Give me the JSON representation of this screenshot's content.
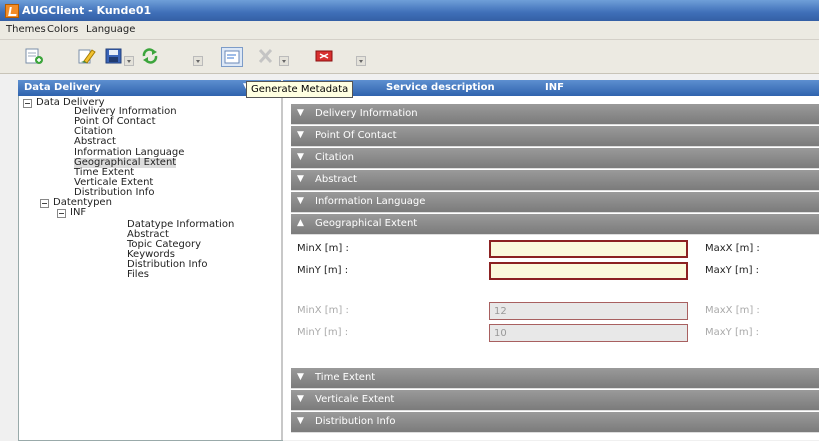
{
  "window": {
    "title": "AUGClient - Kunde01"
  },
  "menu": [
    "Themes",
    "Colors",
    "Language"
  ],
  "toolbar": {
    "buttons": [
      "new-document-icon",
      "edit-icon",
      "save-icon",
      "refresh-icon",
      "generate-metadata-icon",
      "delete-icon",
      "exit-icon"
    ]
  },
  "left_panel": {
    "title": "Data Delivery"
  },
  "tooltip": "Generate Metadata",
  "right_header": {
    "col1": "Service description",
    "col2": "INF"
  },
  "tree": [
    "Data Delivery",
    "Delivery Information",
    "Point Of Contact",
    "Citation",
    "Abstract",
    "Information Language",
    "Geographical Extent",
    "Time Extent",
    "Verticale Extent",
    "Distribution Info",
    "Datentypen",
    "INF",
    "Datatype Information",
    "Abstract",
    "Topic Category",
    "Keywords",
    "Distribution Info",
    "Files"
  ],
  "sections": {
    "delivery_information": "Delivery Information",
    "point_of_contact": "Point Of Contact",
    "citation": "Citation",
    "abstract": "Abstract",
    "information_language": "Information Language",
    "geographical_extent": "Geographical Extent",
    "time_extent": "Time Extent",
    "verticale_extent": "Verticale Extent",
    "distribution_info": "Distribution Info"
  },
  "geo": {
    "minx_label": "MinX [m] :",
    "miny_label": "MinY [m] :",
    "maxx_label": "MaxX [m] :",
    "maxy_label": "MaxY [m] :",
    "minx_value": "",
    "miny_value": "",
    "minx2_value": "12",
    "miny2_value": "10"
  }
}
